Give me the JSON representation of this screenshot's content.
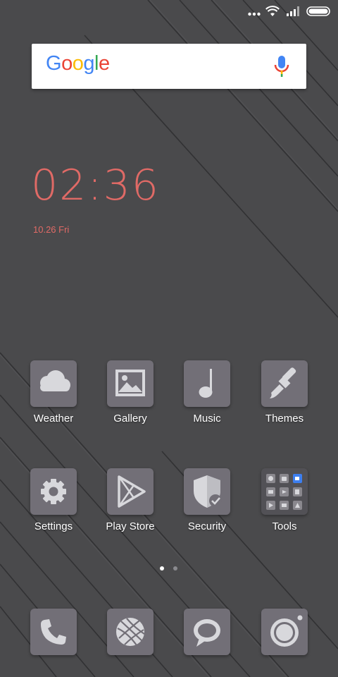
{
  "colors": {
    "background": "#4a4a4c",
    "tile": "#726f77",
    "accent": "#e06a66",
    "label": "#ffffff"
  },
  "status_bar": {
    "icons": [
      "more-dots-icon",
      "wifi-icon",
      "signal-icon",
      "battery-icon"
    ]
  },
  "search": {
    "logo_letters": [
      "G",
      "o",
      "o",
      "g",
      "l",
      "e"
    ],
    "logo_colors": [
      "#4285F4",
      "#EA4335",
      "#FBBC05",
      "#4285F4",
      "#34A853",
      "#EA4335"
    ],
    "mic_icon": "mic-icon"
  },
  "clock": {
    "time": "02:36",
    "date": "10.26 Fri"
  },
  "apps": [
    {
      "label": "Weather",
      "icon": "cloud-icon"
    },
    {
      "label": "Gallery",
      "icon": "image-icon"
    },
    {
      "label": "Music",
      "icon": "music-note-icon"
    },
    {
      "label": "Themes",
      "icon": "paintbrush-icon"
    },
    {
      "label": "Settings",
      "icon": "gear-icon"
    },
    {
      "label": "Play Store",
      "icon": "play-icon"
    },
    {
      "label": "Security",
      "icon": "shield-icon"
    },
    {
      "label": "Tools",
      "icon": "folder-icon"
    }
  ],
  "dock": [
    {
      "icon": "phone-icon"
    },
    {
      "icon": "globe-icon"
    },
    {
      "icon": "chat-bubble-icon"
    },
    {
      "icon": "camera-icon"
    }
  ],
  "page_indicator": {
    "pages": 2,
    "current": 1
  }
}
